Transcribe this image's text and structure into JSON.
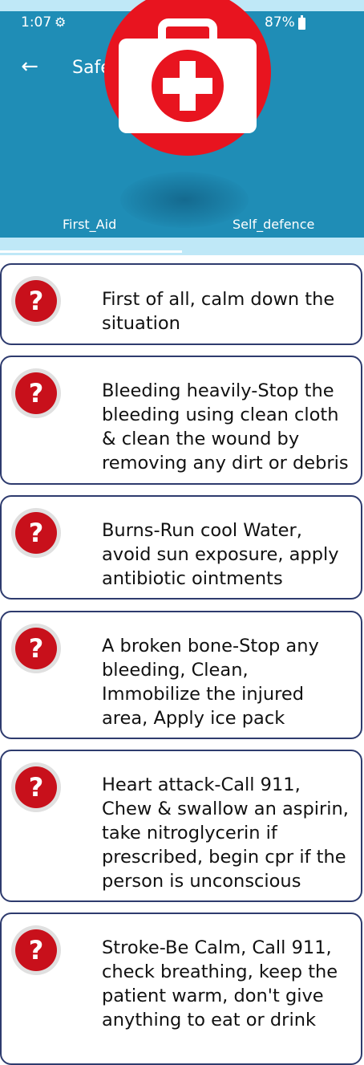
{
  "status_bar": {
    "time": "1:07",
    "battery": "87%"
  },
  "toolbar": {
    "title": "Safety Tips"
  },
  "tabs": [
    {
      "label": "First_Aid"
    },
    {
      "label": "Self_defence"
    }
  ],
  "tips": [
    {
      "text": "First of all, calm down the situation"
    },
    {
      "text": "Bleeding heavily-Stop the bleeding using clean cloth & clean the wound by removing any dirt or debris"
    },
    {
      "text": "Burns-Run cool Water, avoid sun exposure, apply antibiotic ointments"
    },
    {
      "text": "A broken bone-Stop any bleeding, Clean, Immobilize the injured area, Apply ice pack"
    },
    {
      "text": "Heart attack-Call 911, Chew & swallow an aspirin, take nitroglycerin if prescribed, begin cpr if the person is unconscious"
    },
    {
      "text": "Stroke-Be Calm, Call 911, check breathing, keep the patient warm, don't give anything to eat or drink"
    }
  ],
  "colors": {
    "appbar": "#1f8db6",
    "card_border": "#2e3b6e",
    "logo_red": "#e8141f"
  }
}
